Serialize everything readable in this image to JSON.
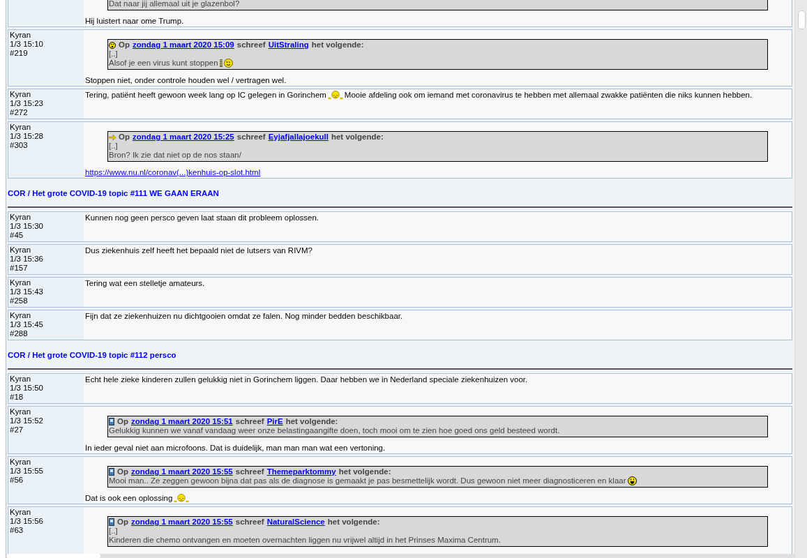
{
  "feed": [
    {
      "kind": "post",
      "quote": {
        "lines": [
          [
            {
              "kind": "text",
              "text": "Dat naar jij allemaal uit je glazenbol?"
            }
          ]
        ]
      },
      "body": [
        [
          {
            "kind": "text",
            "text": "Hij luistert naar ome Trump."
          }
        ]
      ]
    },
    {
      "kind": "post",
      "author": "Kyran",
      "time": "1/3 15:10",
      "number": "#219",
      "quote": {
        "kind": "surprised",
        "prefix": "Op",
        "date": "zondag 1 maart 2020 15:09",
        "middle": "schreef",
        "user": "UitStraling",
        "suffix": "het volgende:",
        "lines": [
          [
            {
              "kind": "text",
              "text": "[..]"
            }
          ],
          [
            {
              "kind": "text",
              "text": "Alsof je een virus kunt stoppen"
            },
            {
              "kind": "bar"
            },
            {
              "kind": "wink"
            }
          ]
        ]
      },
      "body": [
        [
          {
            "kind": "text",
            "text": "Stoppen niet, onder controle houden wel / vertragen wel."
          }
        ]
      ]
    },
    {
      "kind": "post",
      "author": "Kyran",
      "time": "1/3 15:23",
      "number": "#272",
      "body": [
        [
          {
            "kind": "text",
            "text": "Tering, patiënt heeft gewoon week lang op IC gelegen in Gorinchem"
          },
          {
            "kind": "sleepy"
          },
          {
            "kind": "text",
            "text": "Mooie afdeling ook om iemand met coronavirus te hebben met allemaal zwakke patiënten die niks kunnen hebben."
          }
        ]
      ]
    },
    {
      "kind": "post",
      "author": "Kyran",
      "time": "1/3 15:28",
      "number": "#303",
      "quote": {
        "kind": "arrow",
        "prefix": "Op",
        "date": "zondag 1 maart 2020 15:25",
        "middle": "schreef",
        "user": "Eyjafjallajoekull",
        "suffix": "het volgende:",
        "lines": [
          [
            {
              "kind": "text",
              "text": "[..]"
            }
          ],
          [
            {
              "kind": "text",
              "text": "Bron? Ik zie dat niet op de nos staan/"
            }
          ]
        ]
      },
      "body": [
        [
          {
            "kind": "link",
            "text": "https://www.nu.nl/coronav(...)kenhuis-op-slot.html"
          }
        ]
      ]
    },
    {
      "kind": "topic",
      "title": "COR / Het grote COVID-19 topic #111 WE GAAN ERAAN"
    },
    {
      "kind": "post",
      "author": "Kyran",
      "time": "1/3 15:30",
      "number": "#45",
      "body": [
        [
          {
            "kind": "text",
            "text": "Kunnen nog geen persco geven laat staan dit probleem oplossen."
          }
        ]
      ]
    },
    {
      "kind": "post",
      "author": "Kyran",
      "time": "1/3 15:36",
      "number": "#157",
      "body": [
        [
          {
            "kind": "text",
            "text": "Dus ziekenhuis zelf heeft het bepaald niet de lutsers van RIVM?"
          }
        ]
      ]
    },
    {
      "kind": "post",
      "author": "Kyran",
      "time": "1/3 15:43",
      "number": "#258",
      "body": [
        [
          {
            "kind": "text",
            "text": "Tering wat een stelletje amateurs."
          }
        ]
      ]
    },
    {
      "kind": "post",
      "author": "Kyran",
      "time": "1/3 15:45",
      "number": "#288",
      "body": [
        [
          {
            "kind": "text",
            "text": "Fijn dat ze ziekenhuizen nu dichtgooien omdat ze falen. Nog minder bedden beschikbaar."
          }
        ]
      ]
    },
    {
      "kind": "topic",
      "title": "COR / Het grote COVID-19 topic #112 persco"
    },
    {
      "kind": "post",
      "author": "Kyran",
      "time": "1/3 15:50",
      "number": "#18",
      "body": [
        [
          {
            "kind": "text",
            "text": "Echt hele zieke kinderen zullen gelukkig niet in Gorinchem liggen. Daar hebben we in Nederland speciale ziekenhuizen voor."
          }
        ]
      ]
    },
    {
      "kind": "post",
      "author": "Kyran",
      "time": "1/3 15:52",
      "number": "#27",
      "quote": {
        "kind": "device",
        "prefix": "Op",
        "date": "zondag 1 maart 2020 15:51",
        "middle": "schreef",
        "user": "PirE",
        "suffix": "het volgende:",
        "lines": [
          [
            {
              "kind": "text",
              "text": "Gelukkig kunnen we vanaf vandaag weer onze belastingaangifte doen, toch mooi om te zien hoe goed ons geld besteed wordt."
            }
          ]
        ]
      },
      "body": [
        [
          {
            "kind": "text",
            "text": "In ieder geval niet aan microfoons. Dat is duidelijk, man man man wat een vertoning."
          }
        ]
      ]
    },
    {
      "kind": "post",
      "author": "Kyran",
      "time": "1/3 15:55",
      "number": "#56",
      "quote": {
        "kind": "device",
        "prefix": "Op",
        "date": "zondag 1 maart 2020 15:55",
        "middle": "schreef",
        "user": "Themeparktommy",
        "suffix": "het volgende:",
        "lines": [
          [
            {
              "kind": "text",
              "text": "Mooi man.. Ze zeggen gewoon bijna dat pas als de diagnose is gemaakt je pas besmettelijk wordt. Dus gewoon niet meer diagnosticeren en klaar"
            },
            {
              "kind": "grin"
            }
          ]
        ]
      },
      "body": [
        [
          {
            "kind": "text",
            "text": "Dat is ook een oplossing"
          },
          {
            "kind": "sleepy"
          }
        ]
      ]
    },
    {
      "kind": "post",
      "author": "Kyran",
      "time": "1/3 15:56",
      "number": "#63",
      "quote": {
        "kind": "device",
        "prefix": "Op",
        "date": "zondag 1 maart 2020 15:55",
        "middle": "schreef",
        "user": "NaturalScience",
        "suffix": "het volgende:",
        "lines": [
          [
            {
              "kind": "text",
              "text": "[..]"
            }
          ],
          [
            {
              "kind": "text",
              "text": "Kinderen die chemo ontvangen en moeten overnachten liggen nu vrijwel altijd in het Prinses Maxima Centrum."
            }
          ]
        ]
      }
    }
  ]
}
